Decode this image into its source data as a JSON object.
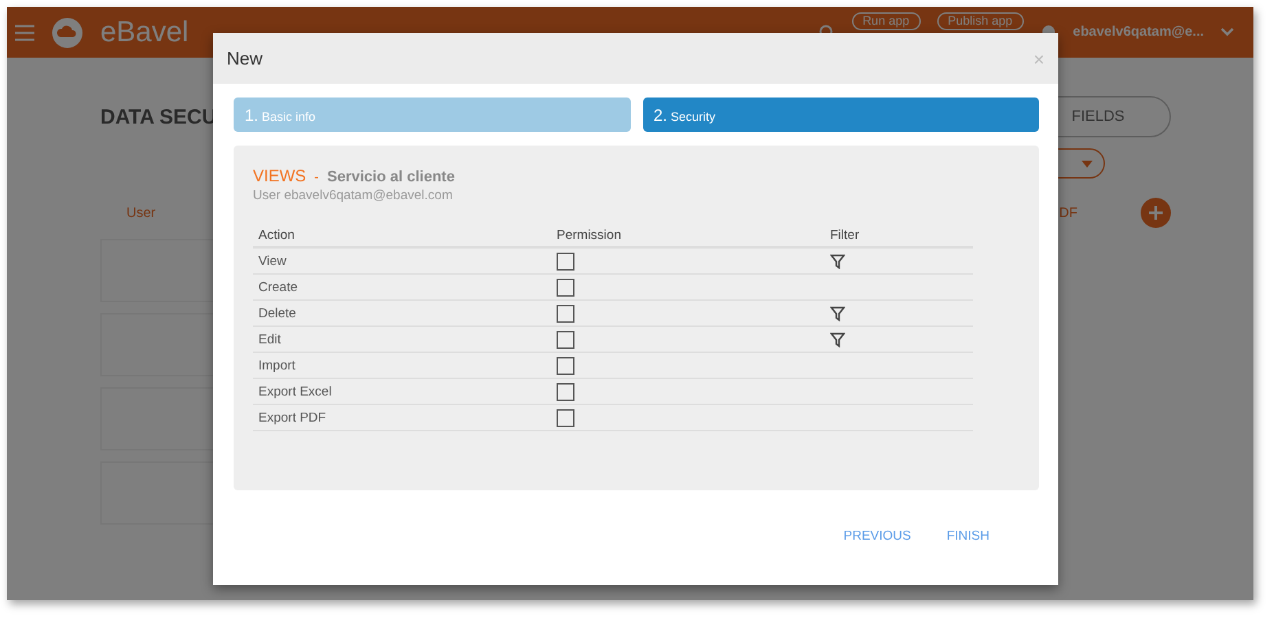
{
  "header": {
    "logo": "eBavel",
    "buttons": [
      "Run app",
      "Publish app"
    ],
    "user": "ebavelv6qatam@e..."
  },
  "page": {
    "title": "DATA SECU",
    "fields_button": "FIELDS",
    "column_user": "User",
    "column_cut": "DF"
  },
  "dialog": {
    "title": "New",
    "close": "×",
    "steps": [
      {
        "number": "1.",
        "label": "Basic info",
        "selected": false
      },
      {
        "number": "2.",
        "label": "Security",
        "selected": true
      }
    ],
    "section": {
      "kind": "VIEWS",
      "separator": "-",
      "name": "Servicio al cliente",
      "user": "User ebavelv6qatam@ebavel.com"
    },
    "columns": [
      "Action",
      "Permission",
      "Filter"
    ],
    "rows": [
      {
        "action": "View",
        "checked": false,
        "filter": true
      },
      {
        "action": "Create",
        "checked": false,
        "filter": false
      },
      {
        "action": "Delete",
        "checked": false,
        "filter": true
      },
      {
        "action": "Edit",
        "checked": false,
        "filter": true
      },
      {
        "action": "Import",
        "checked": false,
        "filter": false
      },
      {
        "action": "Export Excel",
        "checked": false,
        "filter": false
      },
      {
        "action": "Export PDF",
        "checked": false,
        "filter": false
      }
    ],
    "buttons": [
      "PREVIOUS",
      "FINISH"
    ]
  }
}
